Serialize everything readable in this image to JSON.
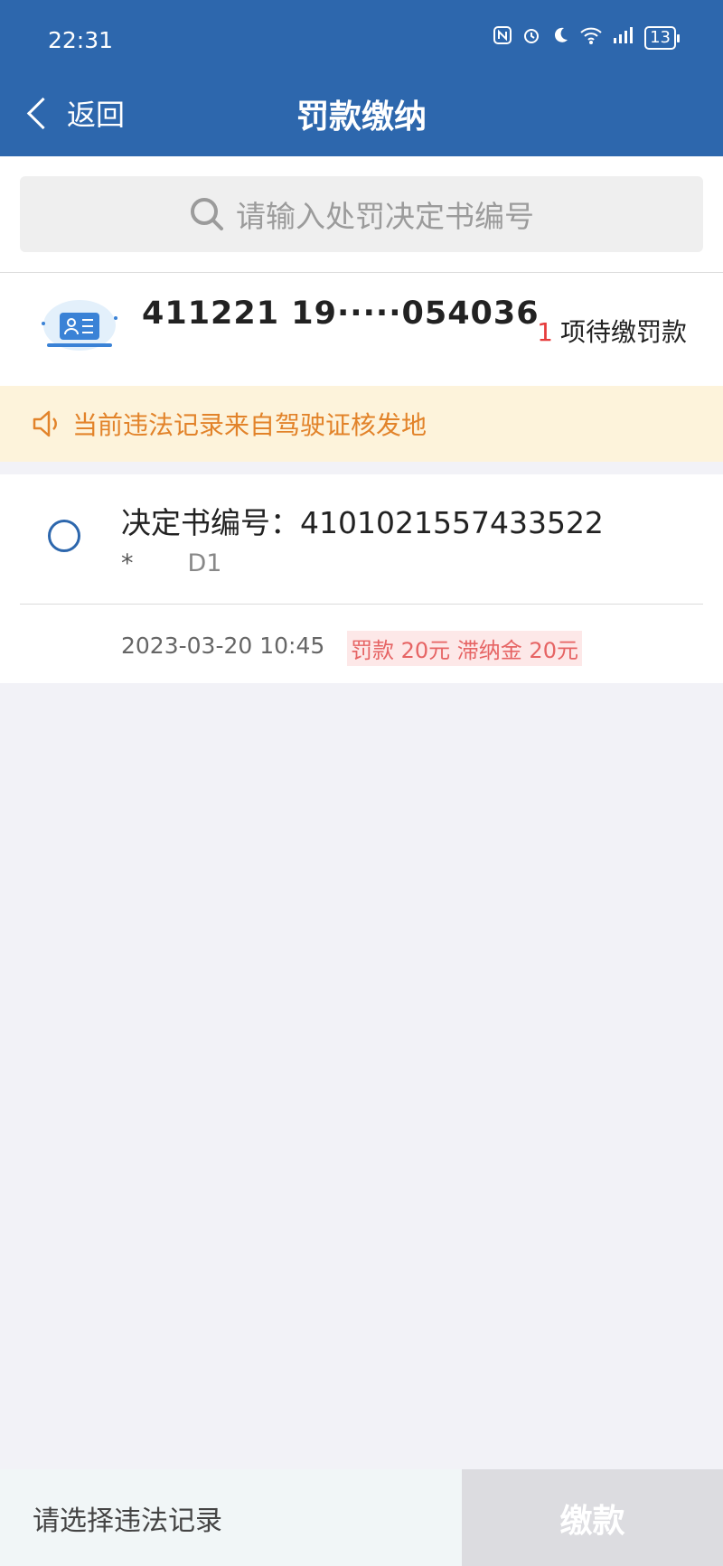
{
  "status_bar": {
    "time": "22:31",
    "icons": [
      "nfc-icon",
      "alarm-icon",
      "moon-icon",
      "wifi-icon",
      "signal-icon"
    ],
    "battery": "13"
  },
  "header": {
    "back_label": "返回",
    "title": "罚款缴纳"
  },
  "search": {
    "placeholder": "请输入处罚决定书编号"
  },
  "driver": {
    "id_number": "411221 19·····054036",
    "name": "",
    "pending_count": "1",
    "pending_label": "项待缴罚款"
  },
  "notice": {
    "text": "当前违法记录来自驾驶证核发地"
  },
  "record": {
    "decision_label": "决定书编号：",
    "decision_number": "4101021557433522",
    "plate_prefix": "*",
    "plate_code": "D1",
    "datetime": "2023-03-20 10:45",
    "fee_text": "罚款 20元 滞纳金 20元"
  },
  "bottom": {
    "hint": "请选择违法记录",
    "pay_label": "缴款"
  },
  "colors": {
    "header_bg": "#2d67ad",
    "notice_bg": "#fdf3db",
    "notice_fg": "#e2832a",
    "fee_fg": "#e66464",
    "pay_disabled_bg": "#dcdce0"
  }
}
